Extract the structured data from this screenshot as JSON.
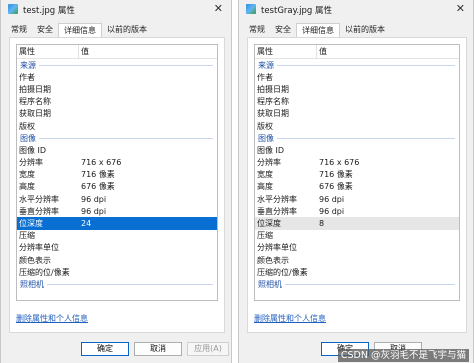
{
  "left_window": {
    "title": "test.jpg 属性",
    "close_glyph": "✕",
    "tabs": [
      "常规",
      "安全",
      "详细信息",
      "以前的版本"
    ],
    "header": {
      "col1": "属性",
      "col2": "值"
    },
    "rows": [
      {
        "type": "group",
        "label": "来源"
      },
      {
        "label": "作者",
        "value": ""
      },
      {
        "label": "拍摄日期",
        "value": ""
      },
      {
        "label": "程序名称",
        "value": ""
      },
      {
        "label": "获取日期",
        "value": ""
      },
      {
        "label": "版权",
        "value": ""
      },
      {
        "type": "group",
        "label": "图像"
      },
      {
        "label": "图像 ID",
        "value": ""
      },
      {
        "label": "分辨率",
        "value": "716 x 676"
      },
      {
        "label": "宽度",
        "value": "716 像素"
      },
      {
        "label": "高度",
        "value": "676 像素"
      },
      {
        "label": "水平分辨率",
        "value": "96 dpi"
      },
      {
        "label": "垂直分辨率",
        "value": "96 dpi"
      },
      {
        "label": "位深度",
        "value": "24",
        "state": "selected"
      },
      {
        "label": "压缩",
        "value": ""
      },
      {
        "label": "分辨率单位",
        "value": ""
      },
      {
        "label": "颜色表示",
        "value": ""
      },
      {
        "label": "压缩的位/像素",
        "value": ""
      },
      {
        "type": "group",
        "label": "照相机"
      }
    ],
    "link": "删除属性和个人信息",
    "buttons": {
      "ok": "确定",
      "cancel": "取消",
      "apply": "应用(A)"
    }
  },
  "right_window": {
    "title": "testGray.jpg 属性",
    "close_glyph": "✕",
    "tabs": [
      "常规",
      "安全",
      "详细信息",
      "以前的版本"
    ],
    "header": {
      "col1": "属性",
      "col2": "值"
    },
    "rows": [
      {
        "type": "group",
        "label": "来源"
      },
      {
        "label": "作者",
        "value": ""
      },
      {
        "label": "拍摄日期",
        "value": ""
      },
      {
        "label": "程序名称",
        "value": ""
      },
      {
        "label": "获取日期",
        "value": ""
      },
      {
        "label": "版权",
        "value": ""
      },
      {
        "type": "group",
        "label": "图像"
      },
      {
        "label": "图像 ID",
        "value": ""
      },
      {
        "label": "分辨率",
        "value": "716 x 676"
      },
      {
        "label": "宽度",
        "value": "716 像素"
      },
      {
        "label": "高度",
        "value": "676 像素"
      },
      {
        "label": "水平分辨率",
        "value": "96 dpi"
      },
      {
        "label": "垂直分辨率",
        "value": "96 dpi"
      },
      {
        "label": "位深度",
        "value": "8",
        "state": "hilite"
      },
      {
        "label": "压缩",
        "value": ""
      },
      {
        "label": "分辨率单位",
        "value": ""
      },
      {
        "label": "颜色表示",
        "value": ""
      },
      {
        "label": "压缩的位/像素",
        "value": ""
      },
      {
        "type": "group",
        "label": "照相机"
      }
    ],
    "link": "删除属性和个人信息",
    "buttons": {
      "ok": "确定",
      "cancel": "取消"
    }
  },
  "watermark": "CSDN @灰羽毛不是飞宇与猫",
  "colors": {
    "selection": "#0a6fd3",
    "link": "#1f5fbf",
    "group_text": "#1f4fa5"
  }
}
